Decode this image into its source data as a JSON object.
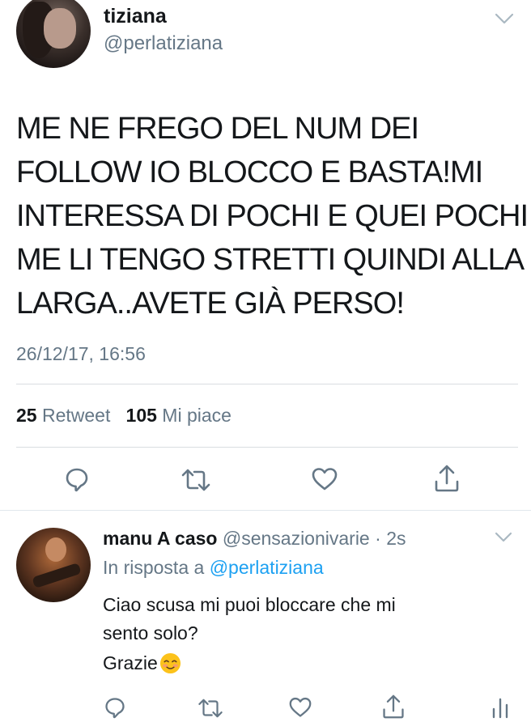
{
  "tweet": {
    "author_name": "tiziana",
    "author_handle": "@perlatiziana",
    "text_lines": [
      "ME NE FREGO DEL NUM DEI",
      "FOLLOW IO BLOCCO E BASTA!MI",
      "INTERESSA DI POCHI E QUEI POCHI",
      "ME LI TENGO STRETTI QUINDI ALLA",
      "LARGA..AVETE GIÀ PERSO!"
    ],
    "timestamp": "26/12/17, 16:56",
    "stats": {
      "retweet_count": "25",
      "retweet_label": "Retweet",
      "like_count": "105",
      "like_label": "Mi piace"
    },
    "icons": [
      "reply-icon",
      "retweet-icon",
      "like-icon",
      "share-icon",
      "chevron-down-icon"
    ]
  },
  "reply": {
    "author_name": "manu A caso",
    "author_handle": "@sensazionivarie",
    "separator": "·",
    "time_ago": "2s",
    "in_reply_prefix": "In risposta a",
    "in_reply_handle": "@perlatiziana",
    "text_line1": "Ciao scusa mi puoi bloccare che mi",
    "text_line2": "sento solo?",
    "text_line3": "Grazie",
    "icons": [
      "reply-icon",
      "retweet-icon",
      "like-icon",
      "share-icon",
      "analytics-icon",
      "smiling-blush-emoji"
    ]
  },
  "colors": {
    "text": "#14171a",
    "secondary": "#657786",
    "link": "#1da1f2",
    "divider": "#d9dde1",
    "icon": "#657786"
  }
}
